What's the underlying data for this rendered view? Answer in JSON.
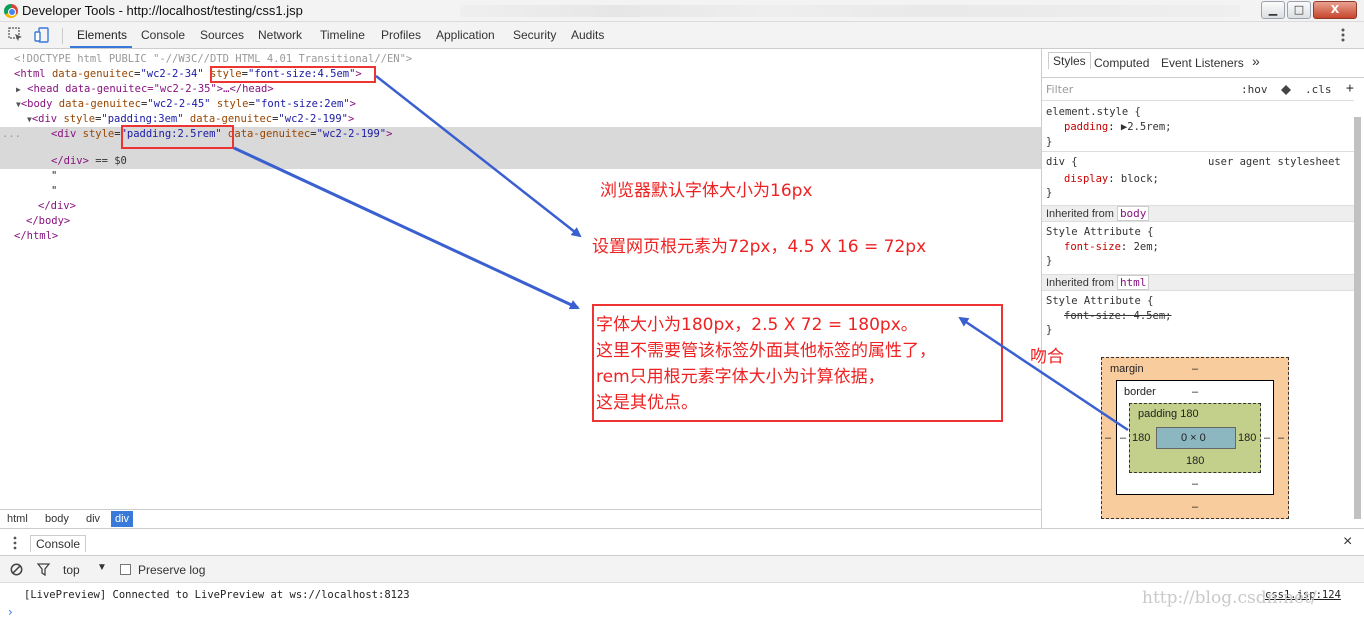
{
  "window": {
    "title": "Developer Tools - http://localhost/testing/css1.jsp",
    "min_label": "▁",
    "max_label": "□",
    "close_label": "X"
  },
  "toolbar": {
    "tabs": [
      "Elements",
      "Console",
      "Sources",
      "Network",
      "Timeline",
      "Profiles",
      "Application",
      "Security",
      "Audits"
    ]
  },
  "elements": {
    "doctype": "<!DOCTYPE html PUBLIC \"-//W3C//DTD HTML 4.01 Transitional//EN\">",
    "html_tag": "<html",
    "html_attr1": "data-genuitec",
    "html_val1": "\"wc2-2-34\"",
    "html_attr2": "style",
    "html_val2": "\"font-size:4.5em\"",
    "html_close": ">",
    "head_line": "<head data-genuitec=\"wc2-2-35\">…</head>",
    "body_tag": "<body",
    "body_attr1": "data-genuitec",
    "body_val1": "\"wc2-2-45\"",
    "body_attr2": "style",
    "body_val2": "\"font-size:2em\"",
    "div1_tag": "<div",
    "div1_attr1": "style",
    "div1_val1": "\"padding:3em\"",
    "div1_attr2": "data-genuitec",
    "div1_val2": "\"wc2-2-199\"",
    "div2_tag": "<div",
    "div2_attr1": "style",
    "div2_val1": "\"padding:2.5rem\"",
    "div2_attr2": "data-genuitec",
    "div2_val2": "\"wc2-2-199\"",
    "div2_close": "</div>",
    "div2_eq": "== $0",
    "quote": "\"",
    "close_div": "</div>",
    "close_body": "</body>",
    "close_html": "</html>",
    "selected_ellipsis": "..."
  },
  "breadcrumb": [
    "html",
    "body",
    "div",
    "div"
  ],
  "styles": {
    "tabs": [
      "Styles",
      "Computed",
      "Event Listeners"
    ],
    "more": "»",
    "filter_placeholder": "Filter",
    "hov": ":hov",
    "cls": ".cls",
    "add": "+",
    "element_style_selector": "element.style {",
    "element_style_prop": "padding",
    "element_style_value": "2.5rem;",
    "div_selector": "div {",
    "ua_label": "user agent stylesheet",
    "div_prop": "display",
    "div_value": "block;",
    "close_brace": "}",
    "inherited_label": "Inherited from",
    "inherited_body": "body",
    "inherited_html": "html",
    "style_attr": "Style Attribute {",
    "body_prop": "font-size",
    "body_value": "2em;",
    "html_prop_struck": "font-size: 4.5em;"
  },
  "boxmodel": {
    "margin_label": "margin",
    "border_label": "border",
    "padding_label": "padding 180",
    "dash": "–",
    "left": "180",
    "right": "180",
    "bottom": "180",
    "content": "0 × 0"
  },
  "drawer": {
    "tab": "Console",
    "context": "top",
    "preserve_log": "Preserve log",
    "message": "[LivePreview] Connected to LivePreview at ws://localhost:8123",
    "source": "css1.jsp:124",
    "prompt": "›",
    "close": "×"
  },
  "annotations": {
    "line1": "浏览器默认字体大小为16px",
    "line2": "设置网页根元素为72px，4.5 X 16 = 72px",
    "box_line1": "字体大小为180px，2.5 X 72 = 180px。",
    "box_line2": "这里不需要管该标签外面其他标签的属性了，",
    "box_line3": "rem只用根元素字体大小为计算依据，",
    "box_line4": "这是其优点。",
    "match": "吻合"
  },
  "watermark": "http://blog.csdn.net/",
  "colors": {
    "accent": "#3879d9",
    "annotation_red": "#e33",
    "arrow_blue": "#3a5fd0"
  }
}
